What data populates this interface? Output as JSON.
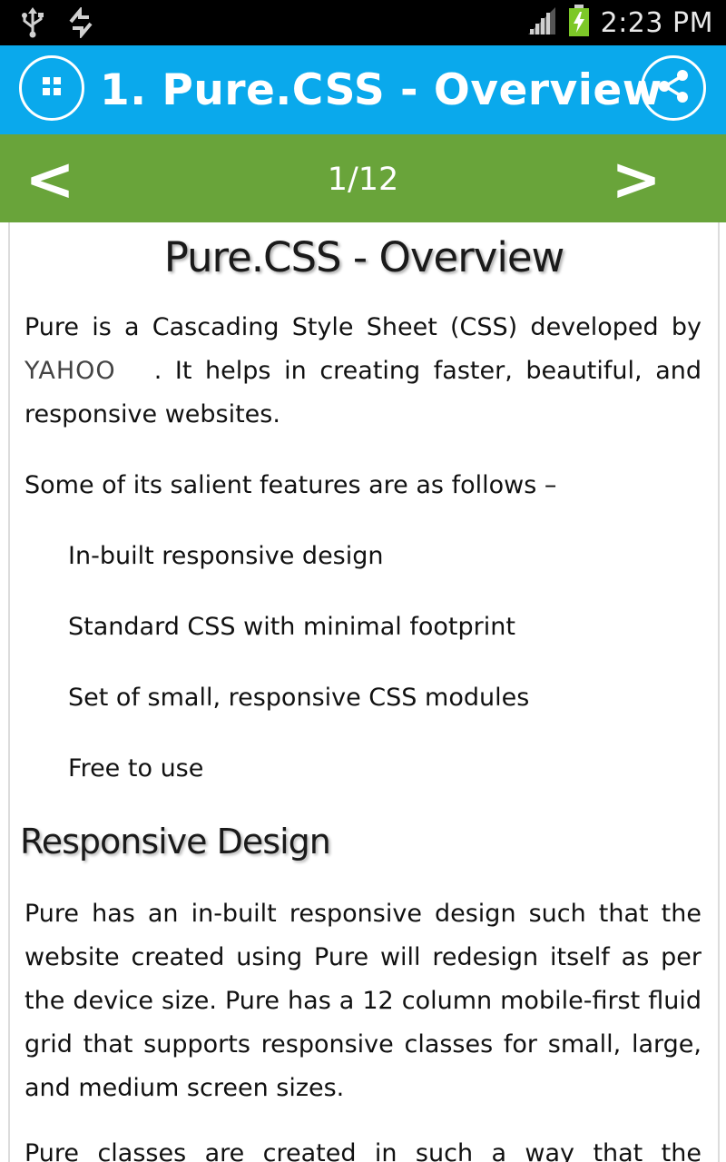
{
  "status_bar": {
    "time": "2:23 PM",
    "icons": [
      "usb-icon",
      "sync-icon",
      "signal-icon",
      "battery-charging-icon"
    ]
  },
  "app_bar": {
    "title": "1. Pure.CSS - Overview",
    "menu_icon": "grid-menu-icon",
    "share_icon": "share-icon",
    "background_color": "#0aa9ec"
  },
  "nav_bar": {
    "prev_label": "<",
    "page_indicator": "1/12",
    "next_label": ">",
    "background_color": "#69a43a"
  },
  "content": {
    "heading": "Pure.CSS - Overview",
    "intro_before": "Pure is a Cascading Style Sheet (CSS) developed by ",
    "intro_brand": "YAHOO",
    "intro_after": ". It helps in creating faster, beautiful, and responsive websites.",
    "features_intro": "Some of its salient features are as follows –",
    "features": [
      "In-built responsive design",
      "Standard CSS with minimal footprint",
      "Set of small, responsive CSS modules",
      "Free to use"
    ],
    "section_heading": "Responsive Design",
    "responsive_paragraph": "Pure has an in-built responsive design such that the website created using Pure will redesign itself as per the device size. Pure has a 12 column mobile-first fluid grid that supports responsive classes for small, large, and medium screen sizes.",
    "classes_paragraph": "Pure classes are created in such a way that the website"
  }
}
